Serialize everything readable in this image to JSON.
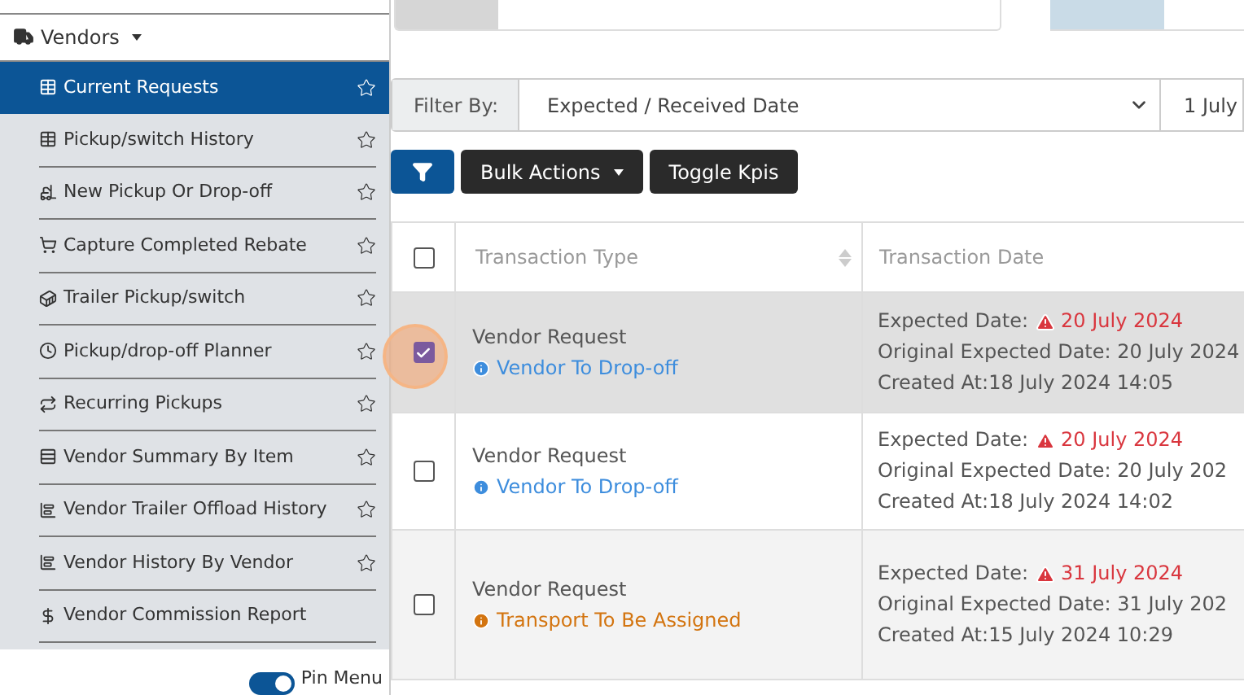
{
  "sidebar": {
    "section": {
      "label": "Vendors",
      "expanded": true
    },
    "items": [
      {
        "label": "Current Requests",
        "selected": true,
        "favorited": false
      },
      {
        "label": "Pickup/switch History",
        "selected": false,
        "favorited": false
      },
      {
        "label": "New Pickup Or Drop-off",
        "selected": false,
        "favorited": false
      },
      {
        "label": "Capture Completed Rebate",
        "selected": false,
        "favorited": false
      },
      {
        "label": "Trailer Pickup/switch",
        "selected": false,
        "favorited": false
      },
      {
        "label": "Pickup/drop-off Planner",
        "selected": false,
        "favorited": false
      },
      {
        "label": "Recurring Pickups",
        "selected": false,
        "favorited": false
      },
      {
        "label": "Vendor Summary By Item",
        "selected": false,
        "favorited": false
      },
      {
        "label": "Vendor Trailer Offload History",
        "selected": false,
        "favorited": false
      },
      {
        "label": "Vendor History By Vendor",
        "selected": false,
        "favorited": false
      },
      {
        "label": "Vendor Commission Report",
        "selected": false
      }
    ],
    "pin_menu": {
      "label": "Pin Menu",
      "on": true
    }
  },
  "filter": {
    "label": "Filter By:",
    "value": "Expected / Received Date",
    "date": "1 July"
  },
  "toolbar": {
    "bulk_actions": "Bulk Actions",
    "toggle_kpis": "Toggle Kpis"
  },
  "table": {
    "all_checked": false,
    "columns": [
      "Transaction Type",
      "Transaction Date"
    ],
    "rows": [
      {
        "checked": true,
        "type": "Vendor Request",
        "status": "Vendor To Drop-off",
        "color": "#3d8ddd",
        "expected_label": "Expected Date:",
        "expected": "20 July 2024",
        "original_label": "Original Expected Date:",
        "original": "20 July 2024",
        "created_label": "Created At:",
        "created": "18 July 2024 14:05"
      },
      {
        "checked": false,
        "type": "Vendor Request",
        "status": "Vendor To Drop-off",
        "color": "#3d8ddd",
        "expected_label": "Expected Date:",
        "expected": "20 July 2024",
        "original_label": "Original Expected Date:",
        "original": "20 July 202",
        "created_label": "Created At:",
        "created": "18 July 2024 14:02"
      },
      {
        "checked": false,
        "type": "Vendor Request",
        "status": "Transport To Be Assigned",
        "color": "#d3740f",
        "expected_label": "Expected Date:",
        "expected": "31 July 2024",
        "original_label": "Original Expected Date:",
        "original": "31 July 202",
        "created_label": "Created At:",
        "created": "15 July 2024 10:29"
      }
    ]
  }
}
